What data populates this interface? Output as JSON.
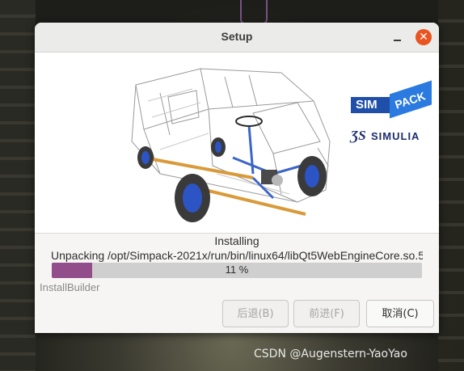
{
  "window": {
    "title": "Setup"
  },
  "banner": {
    "logo_sim": "SIM",
    "logo_pack": "PACK",
    "logo_brand": "SIMULIA"
  },
  "status": {
    "heading": "Installing",
    "path": "Unpacking /opt/Simpack-2021x/run/bin/linux64/libQt5WebEngineCore.so.5",
    "progress_percent": 11,
    "progress_label": "11 %"
  },
  "footer": {
    "brand": "InstallBuilder",
    "back_label": "后退(B)",
    "next_label": "前进(F)",
    "cancel_label": "取消(C)"
  },
  "watermark": "CSDN @Augenstern-YaoYao",
  "colors": {
    "accent": "#924d8b",
    "close": "#e95420",
    "simpack_blue": "#1f6fd1",
    "simulia_navy": "#1e2d6e"
  }
}
